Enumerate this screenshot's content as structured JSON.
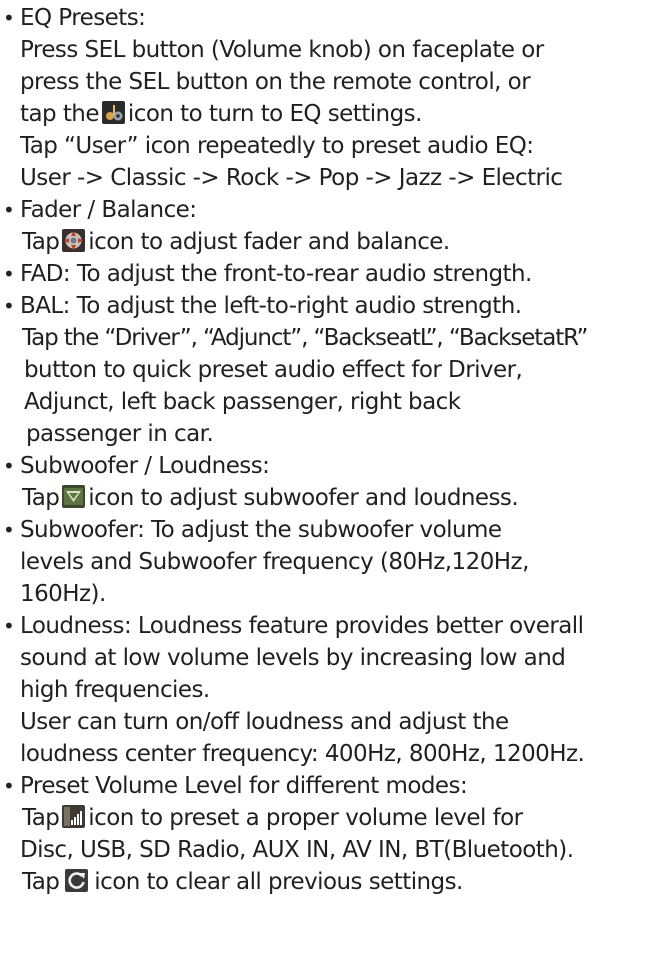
{
  "bullet_char": "•",
  "sections": {
    "eq": {
      "heading": "EQ Presets:",
      "line1": "Press SEL button (Volume knob) on faceplate or",
      "line2": "press the SEL button on the remote control, or",
      "line3_pre": "tap the",
      "line3_post": "icon to turn to EQ settings.",
      "line4": "Tap “User” icon repeatedly to preset audio EQ:",
      "line5": "User -> Classic -> Rock -> Pop -> Jazz -> Electric"
    },
    "fader": {
      "heading": "Fader / Balance:",
      "line1_pre": "Tap",
      "line1_post": "icon to adjust fader and balance."
    },
    "fad": {
      "text": "FAD: To adjust the front-to-rear audio strength."
    },
    "bal": {
      "text": "BAL: To adjust the left-to-right audio strength.",
      "line2": "Tap the “Driver”, “Adjunct”, “BackseatL”, “BacksetatR”",
      "line3": "button to quick preset audio effect for Driver,",
      "line4": "Adjunct, left back passenger, right back",
      "line5": "passenger in car."
    },
    "sub_loud": {
      "heading": "Subwoofer / Loudness:",
      "line1_pre": "Tap",
      "line1_post": "icon to adjust subwoofer and loudness."
    },
    "subwoofer": {
      "text": "Subwoofer: To adjust the subwoofer volume",
      "line2": "levels and Subwoofer frequency (80Hz,120Hz,",
      "line3": "160Hz)."
    },
    "loudness": {
      "text": "Loudness: Loudness feature provides better overall",
      "line2": "sound at low volume levels by increasing low and",
      "line3": "high frequencies.",
      "line4": "User can turn on/off loudness and adjust the",
      "line5": "loudness center frequency: 400Hz, 800Hz, 1200Hz."
    },
    "preset_vol": {
      "heading": "Preset Volume Level for different modes:",
      "line1_pre": "Tap",
      "line1_post": "icon to preset a proper volume level for",
      "line2": "Disc, USB, SD Radio, AUX IN, AV IN, BT(Bluetooth).",
      "line3_pre": "Tap",
      "line3_post": "icon to clear all previous settings."
    }
  },
  "icons": {
    "eq": "eq-settings-icon",
    "fader": "fader-balance-icon",
    "subwoofer": "subwoofer-loudness-icon",
    "volume": "preset-volume-icon",
    "reset": "reset-settings-icon"
  }
}
